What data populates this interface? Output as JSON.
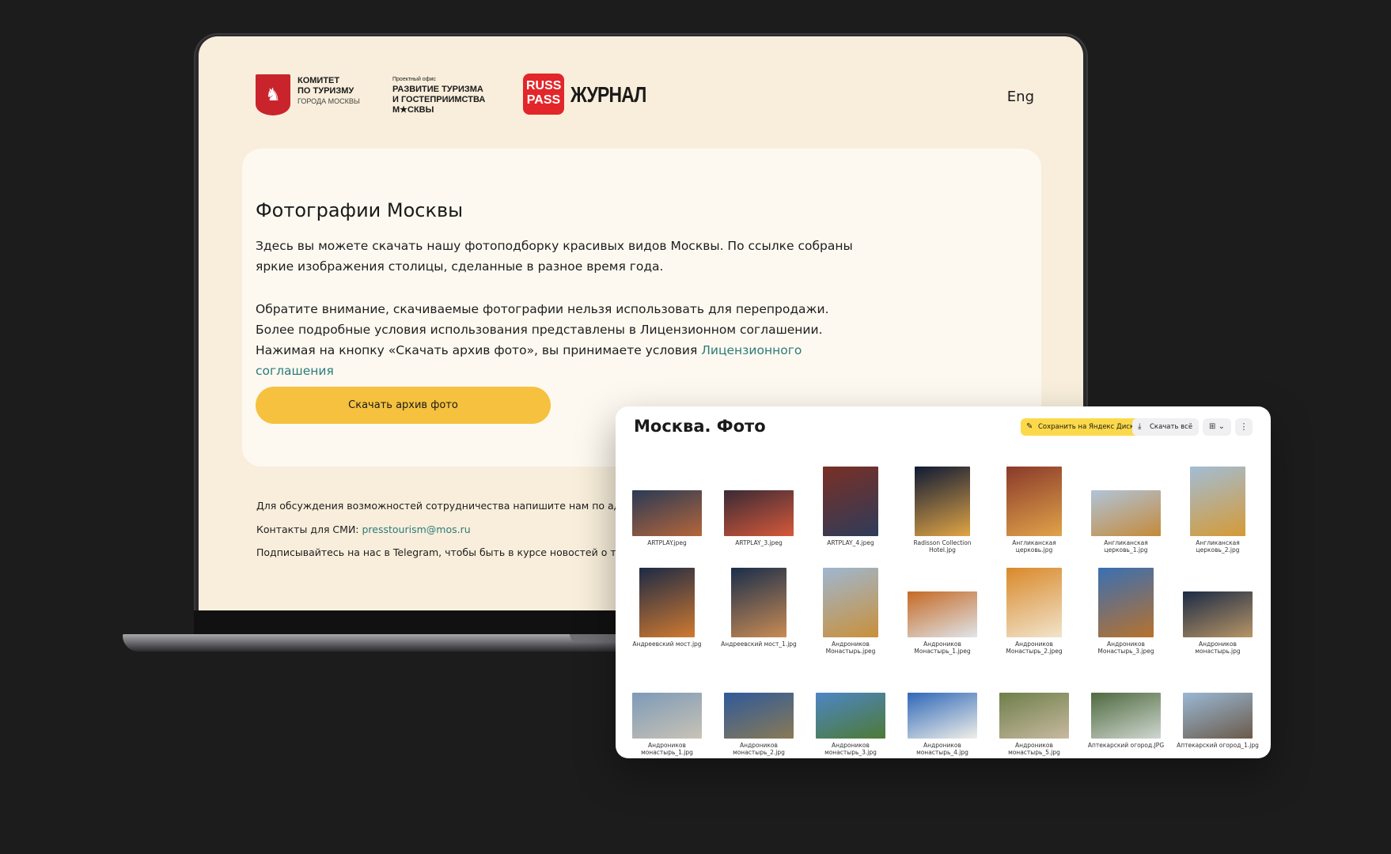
{
  "site": {
    "logo_committee": {
      "line1": "КОМИТЕТ",
      "line2": "ПО ТУРИЗМУ",
      "line3": "ГОРОДА МОСКВЫ"
    },
    "logo_project": {
      "small": "Проектный офис",
      "line1": "РАЗВИТИЕ ТУРИЗМА",
      "line2": "И ГОСТЕПРИИМСТВА",
      "line3": "М★СКВЫ"
    },
    "logo_russpass": {
      "line1": "RUSS",
      "line2": "PASS"
    },
    "logo_journal": "ЖУРНАЛ",
    "lang": "Eng",
    "title": "Фотографии Москвы",
    "p1": "Здесь вы можете скачать нашу фотоподборку красивых видов Москвы. По ссылке собраны яркие изображения столицы, сделанные в разное время года.",
    "p2": "Обратите внимание, скачиваемые фотографии нельзя использовать для перепродажи. Более подробные условия использования представлены в Лицензионном соглашении.",
    "p3_text": "Нажимая на кнопку «Скачать архив фото», вы принимаете условия ",
    "p3_link": "Лицензионного соглашения",
    "download_button": "Скачать архив фото",
    "contact1": "Для обсуждения возможностей сотрудничества напишите нам по адресу",
    "contact2_label": "Контакты для СМИ: ",
    "contact2_email": "presstourism@mos.ru",
    "contact3": "Подписывайтесь на нас в Telegram, чтобы быть в курсе новостей о туриз"
  },
  "disk": {
    "title": "Москва. Фото",
    "save_button": "Сохранить на Яндекс Диск",
    "download_all": "Скачать всё",
    "view_icon": "grid-view-icon",
    "more_icon": "more-vertical-icon",
    "files": [
      {
        "name": "ARTPLAY.jpeg",
        "shape": "land",
        "colors": [
          "#2a3a55",
          "#b5663a"
        ]
      },
      {
        "name": "ARTPLAY_3.jpeg",
        "shape": "land",
        "colors": [
          "#3a2a35",
          "#d6593a"
        ]
      },
      {
        "name": "ARTPLAY_4.jpeg",
        "shape": "port",
        "colors": [
          "#7a2f25",
          "#2e3c5a"
        ]
      },
      {
        "name": "Radisson Collection Hotel.jpg",
        "shape": "port",
        "colors": [
          "#0f1a35",
          "#e1a545"
        ]
      },
      {
        "name": "Англиканская церковь.jpg",
        "shape": "port",
        "colors": [
          "#8a3a2a",
          "#e0a34a"
        ]
      },
      {
        "name": "Англиканская церковь_1.jpg",
        "shape": "land",
        "colors": [
          "#b0c4d9",
          "#c48a3a"
        ]
      },
      {
        "name": "Англиканская церковь_2.jpg",
        "shape": "port",
        "colors": [
          "#a2bdd6",
          "#d59a35"
        ]
      },
      {
        "name": "Андреевский мост.jpg",
        "shape": "port",
        "colors": [
          "#1d2a45",
          "#d07a30"
        ]
      },
      {
        "name": "Андреевский мост_1.jpg",
        "shape": "port",
        "colors": [
          "#1a2e4a",
          "#c98b55"
        ]
      },
      {
        "name": "Андроников Монастырь.jpeg",
        "shape": "port",
        "colors": [
          "#9fb7d0",
          "#c9903a"
        ]
      },
      {
        "name": "Андроников Монастырь_1.jpeg",
        "shape": "land",
        "colors": [
          "#c56a25",
          "#dfe5ea"
        ]
      },
      {
        "name": "Андроников Монастырь_2.jpeg",
        "shape": "port",
        "colors": [
          "#d9892a",
          "#f1e4cc"
        ]
      },
      {
        "name": "Андроников Монастырь_3.jpeg",
        "shape": "port",
        "colors": [
          "#3a6fb3",
          "#b7722d"
        ]
      },
      {
        "name": "Андроников монастырь.jpg",
        "shape": "land",
        "colors": [
          "#1c2b45",
          "#b89566"
        ]
      },
      {
        "name": "Андроников монастырь_1.jpg",
        "shape": "land",
        "colors": [
          "#7d9ab8",
          "#c9c3b5"
        ]
      },
      {
        "name": "Андроников монастырь_2.jpg",
        "shape": "land",
        "colors": [
          "#2e5a9a",
          "#8a7a55"
        ]
      },
      {
        "name": "Андроников монастырь_3.jpg",
        "shape": "land",
        "colors": [
          "#4d86c5",
          "#4d7a35"
        ]
      },
      {
        "name": "Андроников монастырь_4.jpg",
        "shape": "land",
        "colors": [
          "#2f68b8",
          "#f0efe8"
        ]
      },
      {
        "name": "Андроников монастырь_5.jpg",
        "shape": "land",
        "colors": [
          "#6e7f4a",
          "#c8b9a0"
        ]
      },
      {
        "name": "Аптекарский огород.JPG",
        "shape": "land",
        "colors": [
          "#4f6a3f",
          "#cfd7d0"
        ]
      },
      {
        "name": "Аптекарский огород_1.jpg",
        "shape": "land",
        "colors": [
          "#9ab8d4",
          "#6b5a4a"
        ]
      }
    ]
  }
}
